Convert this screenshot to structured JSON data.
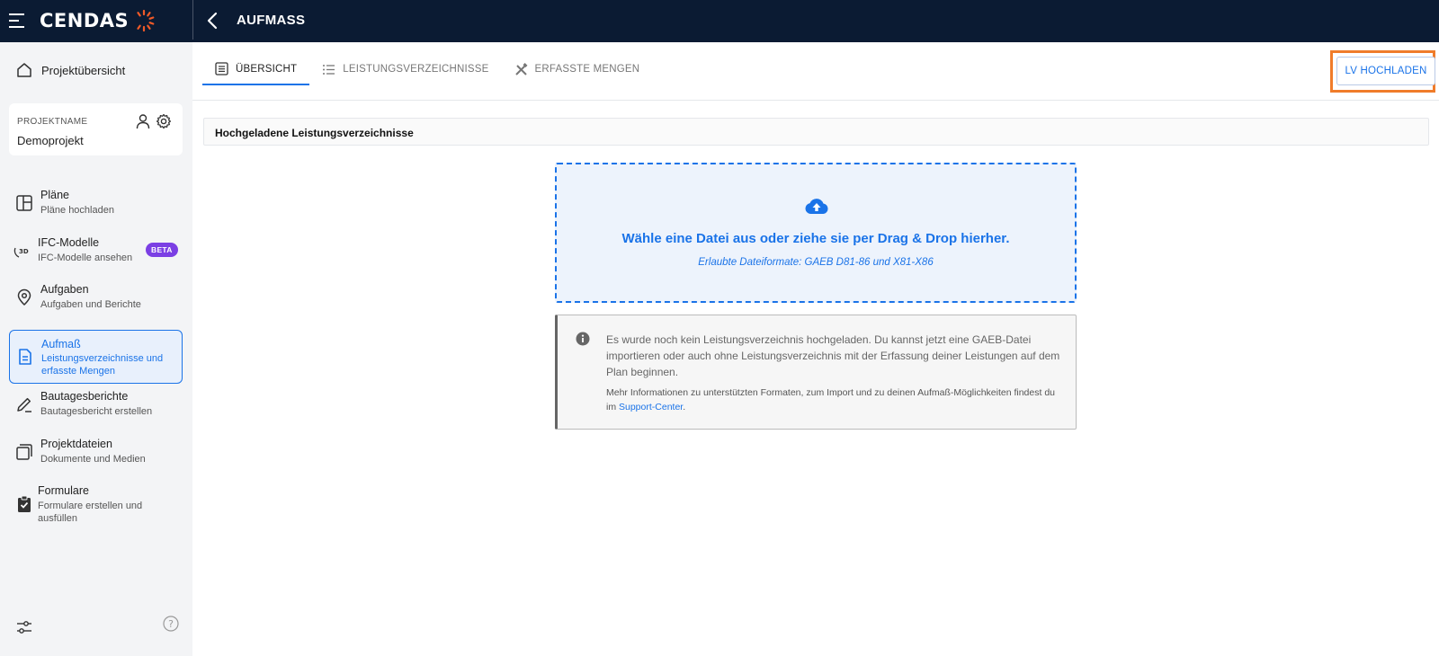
{
  "topbar": {
    "logo_text": "CENDAS",
    "title": "AUFMASS"
  },
  "sidebar": {
    "home_label": "Projektübersicht",
    "project": {
      "label": "PROJEKTNAME",
      "name": "Demoprojekt"
    },
    "items": [
      {
        "title": "Pläne",
        "subtitle": "Pläne hochladen",
        "icon": "plans-icon"
      },
      {
        "title": "IFC-Modelle",
        "subtitle": "IFC-Modelle ansehen",
        "badge": "BETA",
        "icon": "3d-model-icon"
      },
      {
        "title": "Aufgaben",
        "subtitle": "Aufgaben und Berichte",
        "icon": "location-pin-icon"
      },
      {
        "title": "Aufmaß",
        "subtitle": "Leistungsverzeichnisse und erfasste Mengen",
        "icon": "document-icon",
        "active": true
      },
      {
        "title": "Bautagesberichte",
        "subtitle": "Bautagesbericht erstellen",
        "icon": "pencil-icon"
      },
      {
        "title": "Projektdateien",
        "subtitle": "Dokumente und Medien",
        "icon": "files-icon"
      },
      {
        "title": "Formulare",
        "subtitle": "Formulare erstellen und ausfüllen",
        "icon": "clipboard-check-icon"
      }
    ]
  },
  "tabs": [
    {
      "label": "ÜBERSICHT",
      "active": true
    },
    {
      "label": "LEISTUNGSVERZEICHNISSE"
    },
    {
      "label": "ERFASSTE MENGEN"
    }
  ],
  "actions": {
    "upload_label": "LV HOCHLADEN"
  },
  "section": {
    "title": "Hochgeladene Leistungsverzeichnisse"
  },
  "dropzone": {
    "title": "Wähle eine Datei aus oder ziehe sie per Drag & Drop hierher.",
    "formats": "Erlaubte Dateiformate: GAEB D81-86 und X81-X86"
  },
  "info": {
    "text": "Es wurde noch kein Leistungsverzeichnis hochgeladen. Du kannst jetzt eine GAEB-Datei importieren oder auch ohne Leistungsverzeichnis mit der Erfassung deiner Leistungen auf dem Plan beginnen.",
    "more_prefix": "Mehr Informationen zu unterstützten Formaten, zum Import und zu deinen Aufmaß-Möglichkeiten findest du im ",
    "more_link": "Support-Center",
    "more_suffix": "."
  },
  "colors": {
    "topbar_bg": "#0b1b33",
    "accent": "#1a73e8",
    "beta_badge": "#7b3fe4",
    "highlight": "#f07c2a"
  }
}
